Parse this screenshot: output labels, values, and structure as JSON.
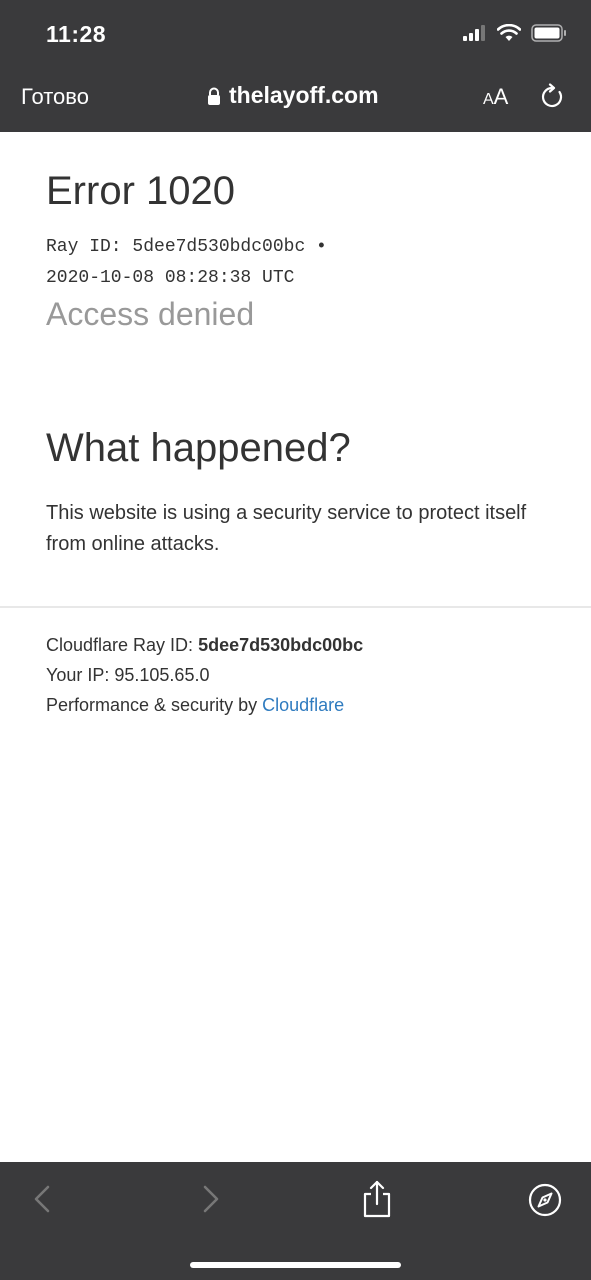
{
  "status": {
    "time": "11:28"
  },
  "nav": {
    "done_label": "Готово",
    "url": "thelayoff.com",
    "text_size_label_small": "A",
    "text_size_label_large": "A"
  },
  "page": {
    "error_title": "Error 1020",
    "ray_line_1": "Ray ID: 5dee7d530bdc00bc •",
    "ray_line_2": "2020-10-08 08:28:38 UTC",
    "access_denied": "Access denied",
    "what_happened_heading": "What happened?",
    "explanation": "This website is using a security service to protect itself from online attacks.",
    "footer": {
      "ray_label": "Cloudflare Ray ID: ",
      "ray_value": "5dee7d530bdc00bc",
      "ip_line": "Your IP: 95.105.65.0",
      "perf_label": "Performance & security by ",
      "cloudflare_link": "Cloudflare"
    }
  },
  "colors": {
    "chrome_bg": "#3a3a3c",
    "link": "#2f7bbf",
    "muted_text": "#999999"
  },
  "icons": [
    "cellular-signal-icon",
    "wifi-icon",
    "battery-icon",
    "lock-icon",
    "reload-icon",
    "back-arrow-icon",
    "forward-arrow-icon",
    "share-icon",
    "compass-icon"
  ]
}
